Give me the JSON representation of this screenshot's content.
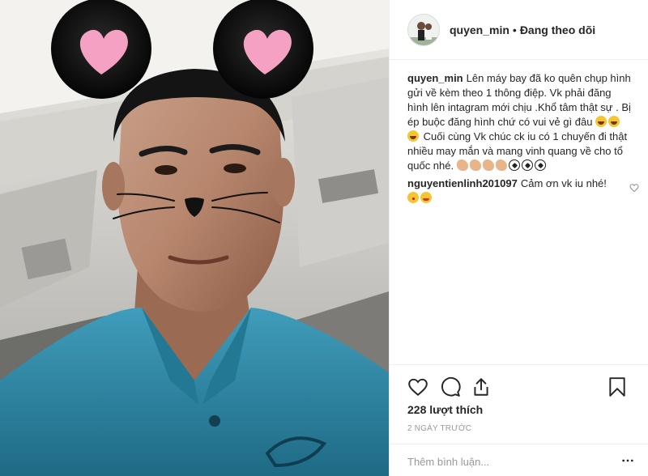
{
  "post": {
    "username": "quyen_min",
    "follow_status": "Đang theo dõi",
    "separator": "•"
  },
  "caption": {
    "username": "quyen_min",
    "text_part1": "Lên máy bay đã ko quên chụp hình gửi về kèm theo 1 thông điệp. Vk phải đăng hình lên intagram mới chịu .Khổ tâm thật sự . Bị ép buộc đăng hình chứ có vui vẻ gì đâu",
    "text_part2": "Cuối cùng Vk chúc ck iu có 1 chuyến đi thật nhiều may mắn và mang vinh quang về cho tổ quốc nhé.",
    "emojis_after_part1": [
      "laughing-emoji",
      "laughing-emoji",
      "laughing-emoji"
    ],
    "emojis_after_part2": [
      "flexed-biceps-emoji",
      "flexed-biceps-emoji",
      "flexed-biceps-emoji",
      "flexed-biceps-emoji",
      "soccer-ball-emoji",
      "soccer-ball-emoji",
      "soccer-ball-emoji"
    ]
  },
  "comments": [
    {
      "username": "nguyentienlinh201097",
      "text": "Cảm ơn vk iu nhé!",
      "emojis": [
        "face-blowing-kiss-emoji",
        "winking-tongue-emoji"
      ]
    }
  ],
  "actions": {
    "like_icon": "heart-icon",
    "comment_icon": "comment-bubble-icon",
    "share_icon": "share-icon",
    "save_icon": "bookmark-icon"
  },
  "likes_text": "228 lượt thích",
  "date_text": "2 NGÀY TRƯỚC",
  "add_comment": {
    "placeholder": "Thêm bình luận...",
    "more_icon": "ellipsis-icon"
  },
  "colors": {
    "border": "#efefef",
    "text": "#262626",
    "muted": "#999999",
    "shirt": "#2f8faa",
    "ear_heart": "#f4a1c4"
  }
}
